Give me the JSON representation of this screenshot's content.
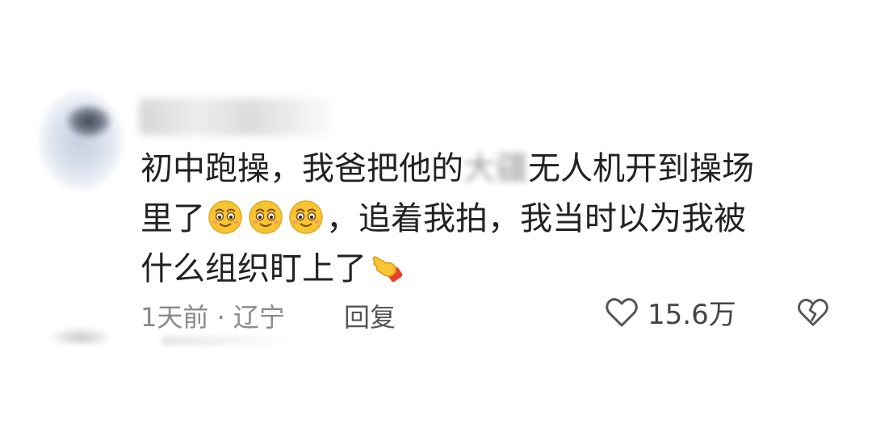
{
  "comment": {
    "line1_a": "初中跑操，我爸把他的",
    "line1_blurred": "大疆",
    "line1_b": "无人机开到操场",
    "line2_a": "里了",
    "line2_b": "，追着我拍，我当时以为我被",
    "line3": "什么组织盯上了"
  },
  "meta": {
    "time_location": "1天前 · 辽宁",
    "reply_label": "回复",
    "like_count": "15.6万"
  },
  "icons": {
    "emoji": "smiling-face-emoji",
    "point": "pointing-hand-emoji",
    "like": "heart-icon",
    "dislike": "broken-heart-icon"
  },
  "colors": {
    "text": "#222222",
    "meta": "#8a8a8a",
    "emoji_face": "#f7c531"
  }
}
